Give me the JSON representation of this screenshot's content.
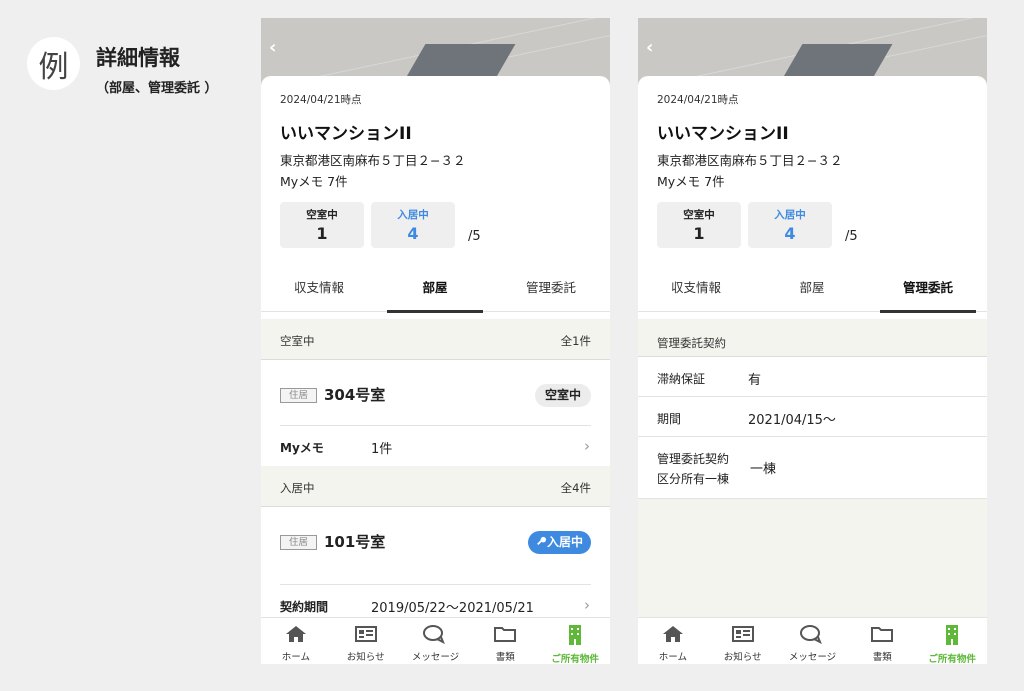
{
  "example": {
    "badge": "例",
    "title": "詳細情報",
    "subtitle": "（部屋、管理委託 ）"
  },
  "property": {
    "date": "2024/04/21時点",
    "name": "いいマンションII",
    "address": "東京都港区南麻布５丁目２−３２",
    "memo": "Myメモ 7件",
    "vacant_label": "空室中",
    "vacant_value": "1",
    "occupied_label": "入居中",
    "occupied_value": "4",
    "total": "/5"
  },
  "tabs": [
    "収支情報",
    "部屋",
    "管理委託"
  ],
  "rooms": {
    "vacant_section": {
      "label": "空室中",
      "count": "全1件"
    },
    "vacant_room": {
      "tag": "住居",
      "number": "304号室",
      "status": "空室中"
    },
    "memo_row": {
      "key": "Myメモ",
      "value": "1件"
    },
    "occupied_section": {
      "label": "入居中",
      "count": "全4件"
    },
    "occupied_room": {
      "tag": "住居",
      "number": "101号室",
      "status": "入居中"
    },
    "contract_row": {
      "key": "契約期間",
      "value": "2019/05/22〜2021/05/21"
    }
  },
  "management": {
    "section": "管理委託契約",
    "guarantee": {
      "key": "滞納保証",
      "value": "有"
    },
    "period": {
      "key": "期間",
      "value": "2021/04/15〜"
    },
    "division": {
      "key1": "管理委託契約",
      "key2": "区分所有一棟",
      "value": "一棟"
    }
  },
  "nav": [
    {
      "label": "ホーム",
      "icon": "home-icon"
    },
    {
      "label": "お知らせ",
      "icon": "news-icon"
    },
    {
      "label": "メッセージ",
      "icon": "message-icon"
    },
    {
      "label": "書類",
      "icon": "folder-icon"
    },
    {
      "label": "ご所有物件",
      "icon": "building-icon"
    }
  ],
  "colors": {
    "accent_blue": "#3d8ae0",
    "accent_green": "#5fb83a"
  }
}
